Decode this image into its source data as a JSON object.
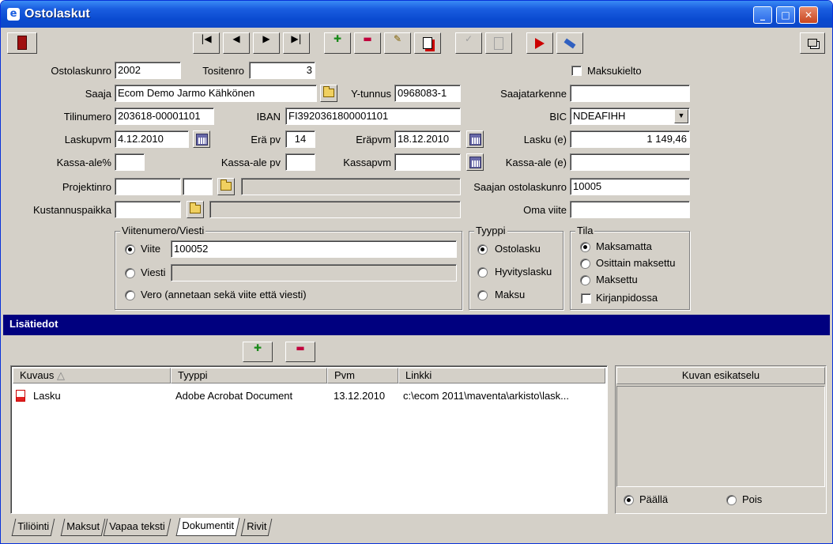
{
  "window": {
    "title": "Ostolaskut",
    "min": "_",
    "max": "□",
    "close": "✕"
  },
  "toolbar": {
    "first": "|◀",
    "prev": "◀",
    "next": "▶",
    "last": "▶|",
    "add": "✚",
    "remove": "▬",
    "edit": "✎",
    "check": "✓"
  },
  "form": {
    "ostolaskunro_label": "Ostolaskunro",
    "ostolaskunro": "2002",
    "tositenro_label": "Tositenro",
    "tositenro": "3",
    "maksukielto_label": "Maksukielto",
    "saaja_label": "Saaja",
    "saaja": "Ecom Demo Jarmo Kähkönen",
    "ytunnus_label": "Y-tunnus",
    "ytunnus": "0968083-1",
    "saajatarkenne_label": "Saajatarkenne",
    "saajatarkenne": "",
    "tilinumero_label": "Tilinumero",
    "tilinumero": "203618-00001101",
    "iban_label": "IBAN",
    "iban": "FI3920361800001101",
    "bic_label": "BIC",
    "bic": "NDEAFIHH",
    "laskupvm_label": "Laskupvm",
    "laskupvm": "4.12.2010",
    "erapv_label": "Erä pv",
    "erapv": "14",
    "erapvm_label": "Eräpvm",
    "erapvm": "18.12.2010",
    "lasku_label": "Lasku (e)",
    "lasku": "1 149,46",
    "kassaale_label": "Kassa-ale%",
    "kassaale": "",
    "kassaalepv_label": "Kassa-ale pv",
    "kassaalepv": "",
    "kassapvm_label": "Kassapvm",
    "kassapvm": "",
    "kassaalee_label": "Kassa-ale (e)",
    "kassaalee": "",
    "projektinro_label": "Projektinro",
    "saajan_ostolaskunro_label": "Saajan ostolaskunro",
    "saajan_ostolaskunro": "10005",
    "kustannuspaikka_label": "Kustannuspaikka",
    "oma_viite_label": "Oma viite",
    "oma_viite": ""
  },
  "viite_group": {
    "title": "Viitenumero/Viesti",
    "viite_label": "Viite",
    "viite": "100052",
    "viesti_label": "Viesti",
    "vero_label": "Vero (annetaan sekä viite että viesti)"
  },
  "tyyppi_group": {
    "title": "Tyyppi",
    "opt1": "Ostolasku",
    "opt2": "Hyvityslasku",
    "opt3": "Maksu"
  },
  "tila_group": {
    "title": "Tila",
    "opt1": "Maksamatta",
    "opt2": "Osittain maksettu",
    "opt3": "Maksettu",
    "kirjanpidossa": "Kirjanpidossa"
  },
  "lisatiedot": {
    "title": "Lisätiedot",
    "columns": [
      "Kuvaus",
      "Tyyppi",
      "Pvm",
      "Linkki"
    ],
    "sort_indicator": "△",
    "rows": [
      {
        "kuvaus": "Lasku",
        "tyyppi": "Adobe Acrobat Document",
        "pvm": "13.12.2010",
        "linkki": "c:\\ecom 2011\\maventa\\arkisto\\lask..."
      }
    ]
  },
  "preview": {
    "title": "Kuvan esikatselu",
    "on": "Päällä",
    "off": "Pois"
  },
  "tabs": [
    "Tiliöinti",
    "Maksut",
    "Vapaa teksti",
    "Dokumentit",
    "Rivit"
  ],
  "colors": {
    "titlebar": "#0a4ad0",
    "section": "#00007f",
    "face": "#d4d0c8"
  }
}
